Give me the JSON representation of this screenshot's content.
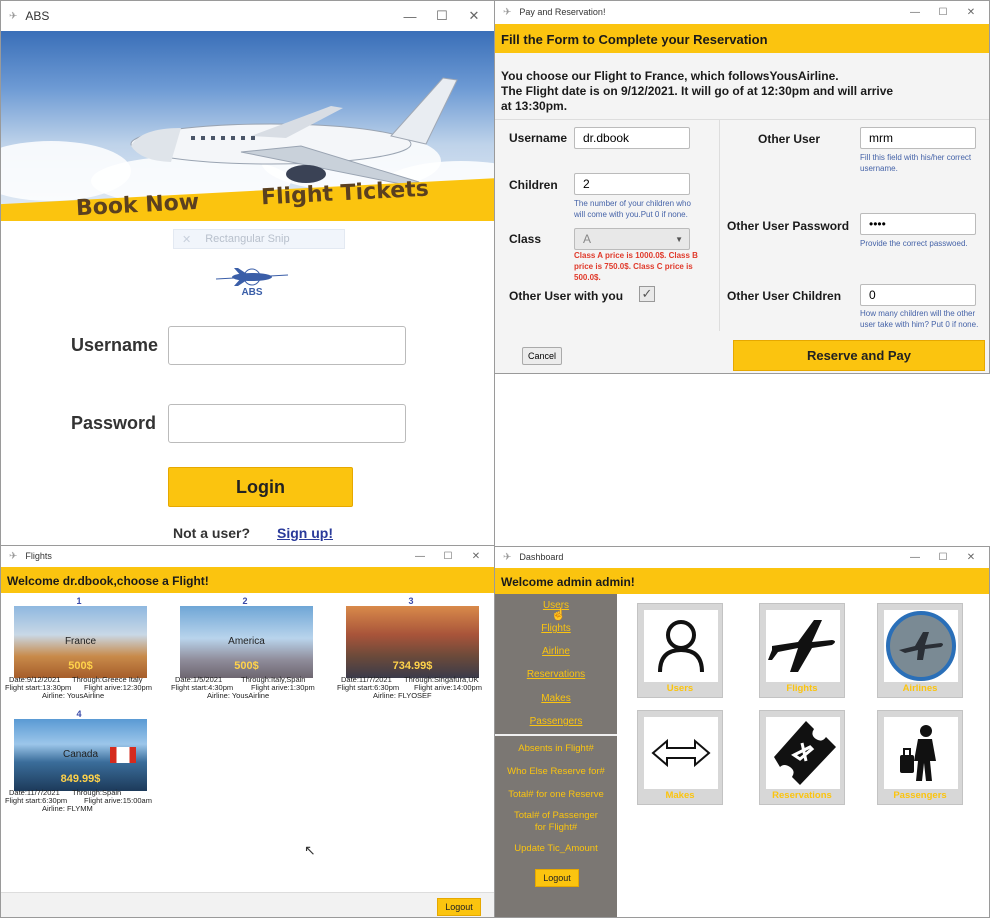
{
  "login": {
    "title": "ABS",
    "banner_left": "Book Now",
    "banner_right": "Flight Tickets",
    "snip_text": "Rectangular Snip",
    "logo_text": "ABS",
    "username_label": "Username",
    "password_label": "Password",
    "login_button": "Login",
    "not_user_text": "Not a user?",
    "signup_link": "Sign up!"
  },
  "reserve": {
    "title": "Pay and Reservation!",
    "header": "Fill the Form to Complete your Reservation",
    "info_line1": "You choose our Flight to France, which followsYousAirline.",
    "info_line2": "The Flight date is on 9/12/2021. It will go of at 12:30pm and will arrive",
    "info_line3": "at 13:30pm.",
    "username_label": "Username",
    "username_value": "dr.dbook",
    "children_label": "Children",
    "children_value": "2",
    "children_help": "The number of your children who will come with you.Put 0 if none.",
    "class_label": "Class",
    "class_value": "A",
    "class_help": "Class A price is 1000.0$. Class B price is 750.0$. Class C price is 500.0$.",
    "other_user_with_label": "Other User with you",
    "other_user_label": "Other User",
    "other_user_value": "mrm",
    "other_user_help": "Fill this field with his/her correct username.",
    "other_pwd_label": "Other User Password",
    "other_pwd_value": "••••",
    "other_pwd_help": "Provide the correct passwoed.",
    "other_children_label": "Other User Children",
    "other_children_value": "0",
    "other_children_help": "How many children will the other user take with him? Put 0 if none.",
    "cancel_button": "Cancel",
    "reserve_button": "Reserve and Pay"
  },
  "flights": {
    "title": "Flights",
    "header": "Welcome dr.dbook,choose a Flight!",
    "logout_button": "Logout",
    "cards": [
      {
        "num": "1",
        "dest": "France",
        "price": "500$",
        "date": "Date:9/12/2021",
        "through": "Through:Greece Italy",
        "start": "Flight start:13:30pm",
        "arrive": "Flight arive:12:30pm",
        "airline": "Airline: YousAirline"
      },
      {
        "num": "2",
        "dest": "America",
        "price": "500$",
        "date": "Date:1/5/2021",
        "through": "Through:Italy,Spain",
        "start": "Flight start:4:30pm",
        "arrive": "Flight arive:1:30pm",
        "airline": "Airline: YousAirline"
      },
      {
        "num": "3",
        "dest": "",
        "price": "734.99$",
        "date": "Date:11/7/2021",
        "through": "Through:Singafura,UK",
        "start": "Flight start:6:30pm",
        "arrive": "Flight arive:14:00pm",
        "airline": "Airline: FLYOSEF"
      },
      {
        "num": "4",
        "dest": "Canada",
        "price": "849.99$",
        "date": "Date:11/7/2021",
        "through": "Through:Spain",
        "start": "Flight start:6:30pm",
        "arrive": "Flight arive:15:00am",
        "airline": "Airline: FLYMM"
      }
    ]
  },
  "dash": {
    "title": "Dashboard",
    "header": "Welcome admin admin!",
    "links": [
      "Users",
      "Flights",
      "Airline",
      "Reservations",
      "Makes",
      "Passengers"
    ],
    "queries": [
      "Absents in Flight#",
      "Who Else Reserve for#",
      "Total# for one Reserve",
      "Total# of Passenger",
      "for Flight#",
      "Update Tic_Amount"
    ],
    "logout_button": "Logout",
    "tiles": [
      "Users",
      "Flights",
      "Airlines",
      "Makes",
      "Reservations",
      "Passengers"
    ]
  },
  "colors": {
    "accent": "#fbc40f",
    "sidebar": "#7b7773",
    "link": "#3a4aa8"
  }
}
